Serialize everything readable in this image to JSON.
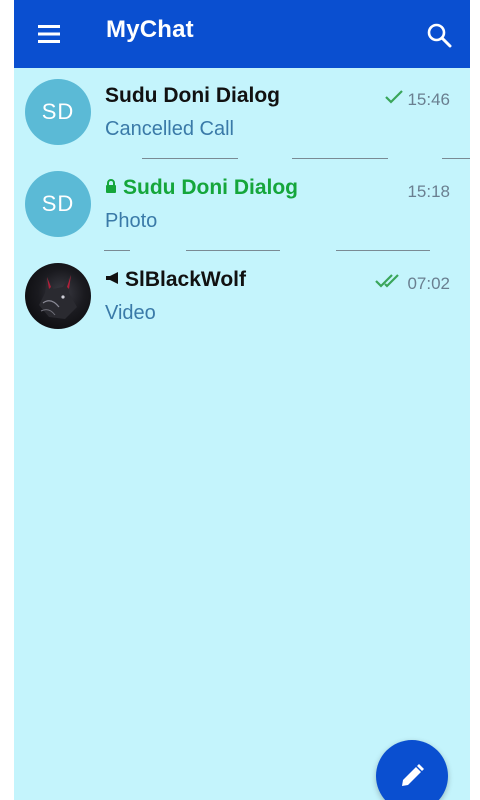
{
  "app": {
    "title": "MyChat"
  },
  "chats": [
    {
      "avatar_initials": "SD",
      "name": "Sudu Doni Dialog",
      "preview": "Cancelled Call",
      "time": "15:46",
      "status": "sent",
      "secret": false
    },
    {
      "avatar_initials": "SD",
      "name": "Sudu Doni Dialog",
      "preview": "Photo",
      "time": "15:18",
      "status": "none",
      "secret": true
    },
    {
      "avatar_initials": "",
      "name": "SlBlackWolf",
      "preview": "Video",
      "time": "07:02",
      "status": "read",
      "channel": true
    }
  ],
  "colors": {
    "appbar": "#0a4fd0",
    "background": "#c4f4fc",
    "avatar": "#5bbad6",
    "secret_name": "#15a63b",
    "check": "#3aa55a"
  }
}
